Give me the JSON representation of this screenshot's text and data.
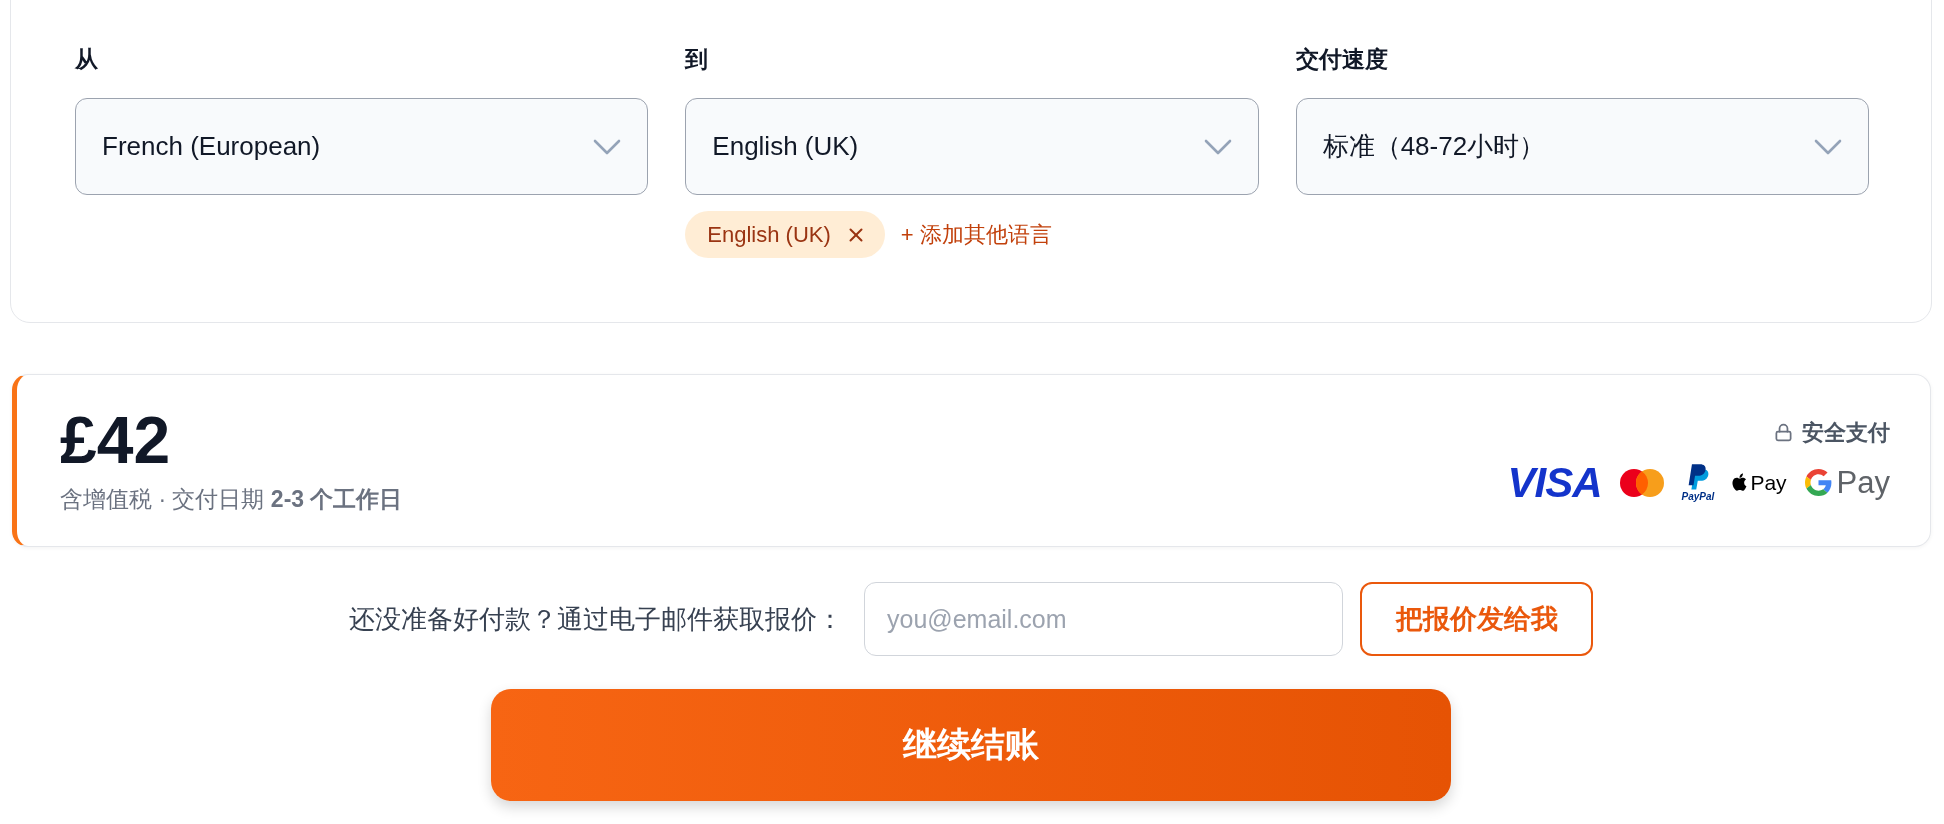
{
  "order_form": {
    "fields": [
      {
        "label": "从",
        "value": "French (European)"
      },
      {
        "label": "到",
        "value": "English (UK)",
        "tags": [
          {
            "label": "English (UK)"
          }
        ],
        "add_link": "+ 添加其他语言"
      },
      {
        "label": "交付速度",
        "value": "标准（48-72小时）"
      }
    ]
  },
  "price_summary": {
    "price": "£42",
    "details": "含增值税 · 交付日期 **2-3 个工作日**",
    "secure_label": "安全支付",
    "payment_methods": [
      {
        "kind": "visa",
        "label": "VISA"
      },
      {
        "kind": "mastercard"
      },
      {
        "kind": "paypal",
        "label": "PayPal"
      },
      {
        "kind": "apple_pay",
        "label": "Pay"
      },
      {
        "kind": "google_pay",
        "label": "Pay"
      }
    ]
  },
  "email_quote": {
    "prompt": "还没准备好付款？通过电子邮件获取报价：",
    "placeholder": "you@email.com",
    "button": "把报价发给我"
  },
  "checkout_button": "继续结账"
}
